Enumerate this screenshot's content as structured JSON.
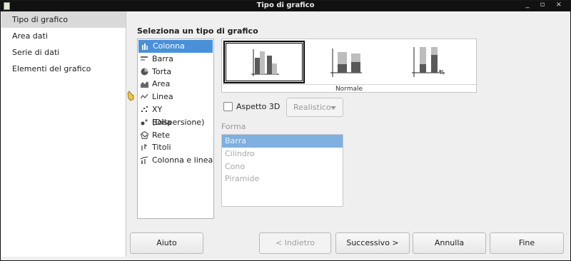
{
  "window": {
    "title": "Tipo di grafico",
    "controls": "_ ▫ ×"
  },
  "sidebar": {
    "items": [
      {
        "label": "Tipo di grafico",
        "active": true
      },
      {
        "label": "Area dati"
      },
      {
        "label": "Serie di dati"
      },
      {
        "label": "Elementi del grafico"
      }
    ]
  },
  "main": {
    "heading": "Seleziona un tipo di grafico"
  },
  "chart_types": [
    {
      "label": "Colonna",
      "icon": "column-chart-icon",
      "selected": true
    },
    {
      "label": "Barra",
      "icon": "bar-chart-icon"
    },
    {
      "label": "Torta",
      "icon": "pie-chart-icon"
    },
    {
      "label": "Area",
      "icon": "area-chart-icon"
    },
    {
      "label": "Linea",
      "icon": "line-chart-icon"
    },
    {
      "label": "XY (Dispersione)",
      "icon": "scatter-chart-icon"
    },
    {
      "label": "Bolla",
      "icon": "bubble-chart-icon"
    },
    {
      "label": "Rete",
      "icon": "net-chart-icon"
    },
    {
      "label": "Titoli",
      "icon": "stock-chart-icon"
    },
    {
      "label": "Colonna e linea",
      "icon": "column-line-chart-icon"
    }
  ],
  "variants": {
    "caption": "Normale",
    "percent_symbol": "%"
  },
  "options": {
    "aspect3d_label": "Aspetto 3D",
    "aspect3d_checked": false,
    "look_value": "Realistico"
  },
  "shape": {
    "label": "Forma",
    "items": [
      {
        "label": "Barra",
        "selected": true
      },
      {
        "label": "Cilindro"
      },
      {
        "label": "Cono"
      },
      {
        "label": "Piramide"
      }
    ]
  },
  "buttons": {
    "help": "Aiuto",
    "back": "< Indietro",
    "next": "Successivo >",
    "cancel": "Annulla",
    "finish": "Fine"
  },
  "colors": {
    "selection": "#4a90d9",
    "titlebar": "#111111",
    "bar_dark": "#595959",
    "bar_light": "#bdbdbd"
  }
}
